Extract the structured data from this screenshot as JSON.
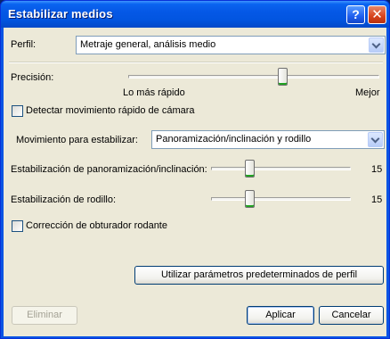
{
  "window": {
    "title": "Estabilizar medios"
  },
  "profile": {
    "label": "Perfil:",
    "value": "Metraje general, análisis medio"
  },
  "precision": {
    "label": "Precisión:",
    "min_label": "Lo más rápido",
    "max_label": "Mejor",
    "level": 0.62
  },
  "fast_motion": {
    "label": "Detectar movimiento rápido de cámara",
    "checked": false
  },
  "motion": {
    "label": "Movimiento para estabilizar:",
    "value": "Panoramización/inclinación y rodillo"
  },
  "pan_tilt": {
    "label": "Estabilización de panoramización/inclinación:",
    "value": "15",
    "level": 0.26
  },
  "roll": {
    "label": "Estabilización de rodillo:",
    "value": "15",
    "level": 0.26
  },
  "rolling_shutter": {
    "label": "Corrección de obturador rodante",
    "checked": false
  },
  "buttons": {
    "defaults": "Utilizar parámetros predeterminados de perfil",
    "remove": "Eliminar",
    "apply": "Aplicar",
    "cancel": "Cancelar"
  }
}
